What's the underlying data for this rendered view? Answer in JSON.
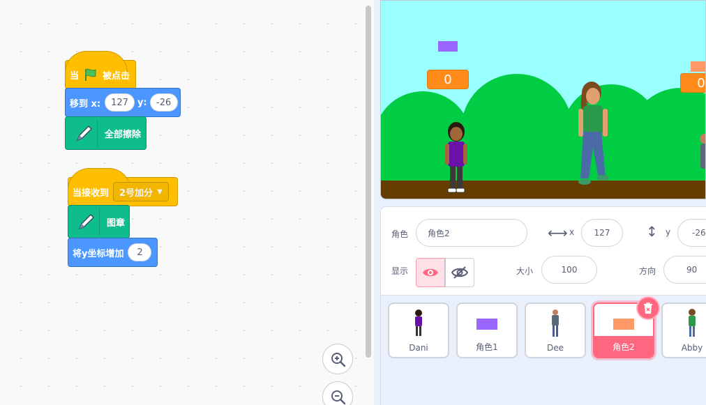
{
  "blocks": {
    "when_flag": {
      "prefix": "当",
      "suffix": "被点击"
    },
    "goto": {
      "label": "移到 x:",
      "x_value": "127",
      "y_label": "y:",
      "y_value": "-26"
    },
    "clear": {
      "label": "全部擦除"
    },
    "when_receive": {
      "label": "当接收到",
      "message": "2号加分"
    },
    "stamp": {
      "label": "图章"
    },
    "change_y": {
      "label": "将y坐标增加",
      "value": "2"
    }
  },
  "stage": {
    "monitor_left": "0",
    "monitor_right": "0"
  },
  "sprite_info": {
    "sprite_label": "角色",
    "sprite_name": "角色2",
    "x_label": "x",
    "x_value": "127",
    "y_label": "y",
    "y_value": "-26",
    "show_label": "显示",
    "size_label": "大小",
    "size_value": "100",
    "direction_label": "方向",
    "direction_value": "90"
  },
  "sprites": [
    {
      "name": "Dani"
    },
    {
      "name": "角色1"
    },
    {
      "name": "Dee"
    },
    {
      "name": "角色2",
      "selected": true
    },
    {
      "name": "Abby"
    }
  ],
  "colors": {
    "events": "#ffbf00",
    "motion": "#4c97ff",
    "pen": "#0fbd8c",
    "monitor": "#ff8c1a",
    "selected": "#ff6680"
  }
}
